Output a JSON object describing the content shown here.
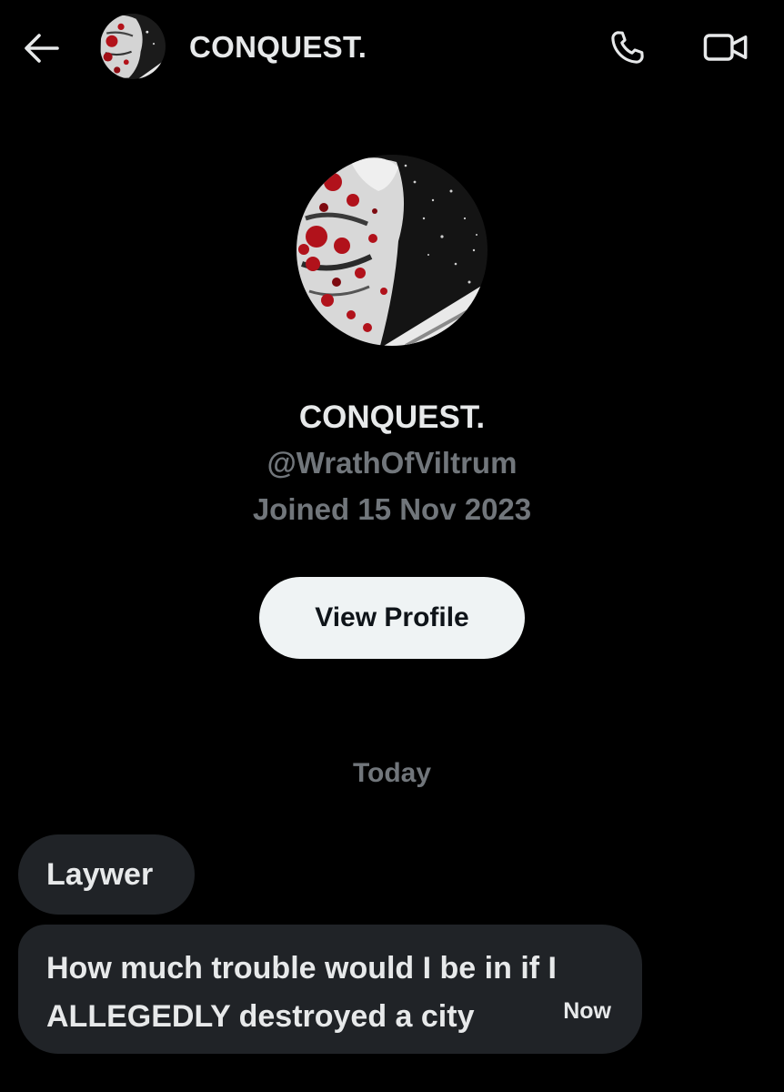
{
  "header": {
    "title": "CONQUEST.",
    "back_icon": "arrow-left-icon",
    "call_icon": "phone-icon",
    "video_icon": "video-camera-icon"
  },
  "profile": {
    "name": "CONQUEST.",
    "handle": "@WrathOfViltrum",
    "joined": "Joined 15 Nov 2023",
    "view_profile_label": "View Profile"
  },
  "conversation": {
    "date_separator": "Today",
    "messages": [
      {
        "text": "Laywer"
      },
      {
        "text": "How much trouble would I be in if I ALLEGEDLY destroyed a city",
        "time": "Now"
      }
    ]
  },
  "colors": {
    "background": "#000000",
    "primary_text": "#e7e9ea",
    "secondary_text": "#71767b",
    "bubble": "#202327",
    "button_bg": "#eff3f4",
    "button_text": "#0f1419"
  }
}
